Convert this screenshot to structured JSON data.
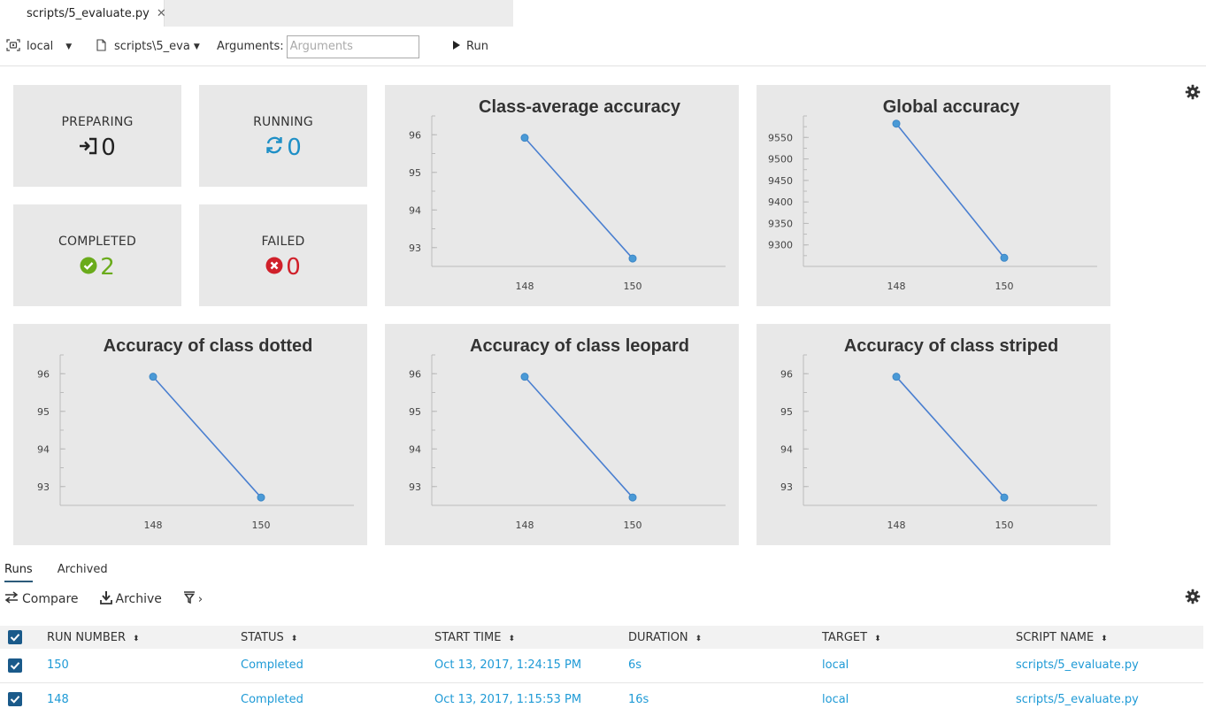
{
  "tab": {
    "title": "scripts/5_evaluate.py",
    "close_glyph": "✕"
  },
  "toolbar": {
    "target": "local",
    "script": "scripts\\5_eva",
    "arguments_label": "Arguments:",
    "arguments_placeholder": "Arguments",
    "run_label": "Run"
  },
  "status": [
    {
      "label": "PREPARING",
      "count": "0",
      "icon": "sign-in-icon",
      "color": "#222222"
    },
    {
      "label": "RUNNING",
      "count": "0",
      "icon": "refresh-icon",
      "color": "#1e8fc6"
    },
    {
      "label": "COMPLETED",
      "count": "2",
      "icon": "check-circle-icon",
      "color": "#6aab1b"
    },
    {
      "label": "FAILED",
      "count": "0",
      "icon": "x-circle-icon",
      "color": "#d0202a"
    }
  ],
  "chart_data": [
    {
      "type": "line",
      "title": "Class-average accuracy",
      "x": [
        "148",
        "150"
      ],
      "y": [
        95.92,
        92.71
      ],
      "yticks": [
        93,
        94,
        95,
        96
      ],
      "ylim": [
        92.5,
        96.5
      ]
    },
    {
      "type": "line",
      "title": "Global accuracy",
      "x": [
        "148",
        "150"
      ],
      "y": [
        9582,
        9270
      ],
      "yticks": [
        9300,
        9350,
        9400,
        9450,
        9500,
        9550
      ],
      "ylim": [
        9250,
        9600
      ]
    },
    {
      "type": "line",
      "title": "Accuracy of class dotted",
      "x": [
        "148",
        "150"
      ],
      "y": [
        95.92,
        92.71
      ],
      "yticks": [
        93,
        94,
        95,
        96
      ],
      "ylim": [
        92.5,
        96.5
      ]
    },
    {
      "type": "line",
      "title": "Accuracy of class leopard",
      "x": [
        "148",
        "150"
      ],
      "y": [
        95.92,
        92.71
      ],
      "yticks": [
        93,
        94,
        95,
        96
      ],
      "ylim": [
        92.5,
        96.5
      ]
    },
    {
      "type": "line",
      "title": "Accuracy of class striped",
      "x": [
        "148",
        "150"
      ],
      "y": [
        95.92,
        92.71
      ],
      "yticks": [
        93,
        94,
        95,
        96
      ],
      "ylim": [
        92.5,
        96.5
      ]
    }
  ],
  "colors": {
    "line": "#4a7fd0",
    "marker": "#4a9ad6",
    "link": "#1e9ad6",
    "checkbox": "#1a5a8a"
  },
  "runs": {
    "tabs": [
      "Runs",
      "Archived"
    ],
    "actions": [
      "Compare",
      "Archive"
    ],
    "columns": [
      "RUN NUMBER",
      "STATUS",
      "START TIME",
      "DURATION",
      "TARGET",
      "SCRIPT NAME"
    ],
    "rows": [
      {
        "run": "150",
        "status": "Completed",
        "start": "Oct 13, 2017, 1:24:15 PM",
        "duration": "6s",
        "target": "local",
        "script": "scripts/5_evaluate.py"
      },
      {
        "run": "148",
        "status": "Completed",
        "start": "Oct 13, 2017, 1:15:53 PM",
        "duration": "16s",
        "target": "local",
        "script": "scripts/5_evaluate.py"
      }
    ]
  }
}
